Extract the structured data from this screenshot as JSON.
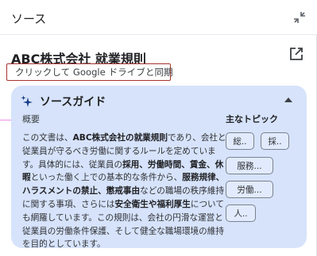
{
  "header": {
    "title": "ソース"
  },
  "source": {
    "title": "ABC株式会社 就業規則",
    "sync_label": "クリックして Google ドライブと同期"
  },
  "guide": {
    "title": "ソースガイド",
    "summary_label": "概要",
    "summary_parts": [
      {
        "text": "この文書は、",
        "bold": false
      },
      {
        "text": "ABC株式会社の就業規則",
        "bold": true
      },
      {
        "text": "であり、会社と従業員が守るべき労働に関するルールを定めています。具体的には、従業員の",
        "bold": false
      },
      {
        "text": "採用、労働時間、賃金、休暇",
        "bold": true
      },
      {
        "text": "といった働く上での基本的な条件から、",
        "bold": false
      },
      {
        "text": "服務規律、ハラスメントの禁止、懲戒事由",
        "bold": true
      },
      {
        "text": "などの職場の秩序維持に関する事項、さらには",
        "bold": false
      },
      {
        "text": "安全衛生や福利厚生",
        "bold": true
      },
      {
        "text": "についても網羅しています。この規則は、会社の円滑な運営と従業員の労働条件保護、そして健全な職場環境の維持を目的としています。",
        "bold": false
      }
    ],
    "topics_label": "主なトピック",
    "topics": [
      "総..",
      "採..",
      "服務...",
      "労働...",
      "人.."
    ]
  }
}
